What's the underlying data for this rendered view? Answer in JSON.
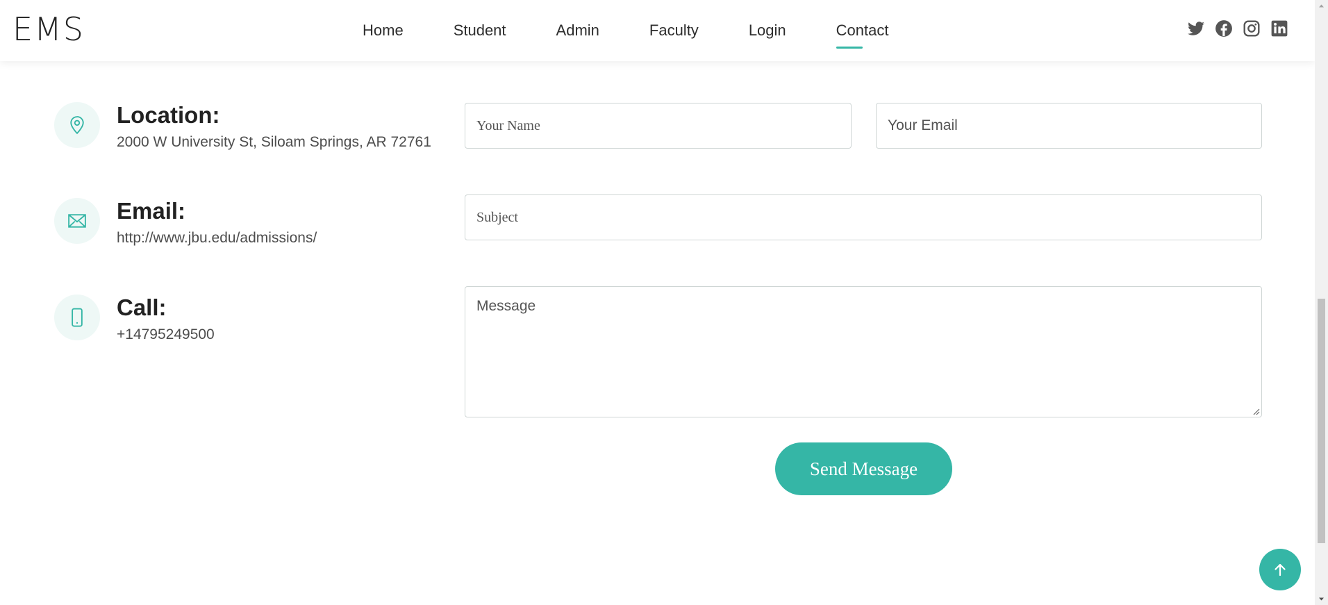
{
  "brand": {
    "logo": "EMS"
  },
  "nav": {
    "items": [
      {
        "label": "Home"
      },
      {
        "label": "Student"
      },
      {
        "label": "Admin"
      },
      {
        "label": "Faculty"
      },
      {
        "label": "Login"
      },
      {
        "label": "Contact",
        "active": true
      }
    ]
  },
  "social": [
    "twitter-icon",
    "facebook-icon",
    "instagram-icon",
    "linkedin-icon"
  ],
  "contact_info": {
    "location": {
      "title": "Location:",
      "value": "2000 W University St, Siloam Springs, AR 72761",
      "icon": "map-pin-icon"
    },
    "email": {
      "title": "Email:",
      "value": "http://www.jbu.edu/admissions/",
      "icon": "envelope-icon"
    },
    "call": {
      "title": "Call:",
      "value": "+14795249500",
      "icon": "phone-icon"
    }
  },
  "form": {
    "name_placeholder": "Your Name",
    "email_placeholder": "Your Email",
    "subject_placeholder": "Subject",
    "message_placeholder": "Message",
    "submit_label": "Send Message"
  },
  "colors": {
    "accent": "#35b6a6",
    "icon_bg": "#eef8f6",
    "text": "#222222",
    "muted": "#4d4d4d"
  }
}
